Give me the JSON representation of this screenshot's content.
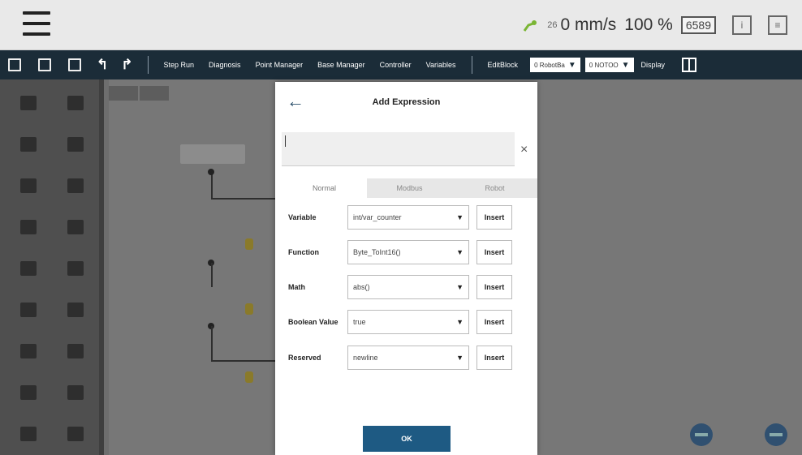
{
  "status": {
    "speed_value": "0 mm/s",
    "speed_prefix": "26",
    "override": "100 %",
    "counter": "6589"
  },
  "toolbar": {
    "step_run": "Step Run",
    "diagnosis": "Diagnosis",
    "point_manager": "Point Manager",
    "base_manager": "Base Manager",
    "controller": "Controller",
    "variables": "Variables",
    "edit_block": "EditBlock",
    "robot_dd": "0 RobotBa",
    "tool_dd": "0 NOTOO",
    "display": "Display"
  },
  "dialog": {
    "title": "Add Expression",
    "expression_value": "",
    "tabs": [
      "Normal",
      "Modbus",
      "Robot"
    ],
    "active_tab": "Normal",
    "rows": [
      {
        "label": "Variable",
        "value": "int/var_counter",
        "button": "Insert"
      },
      {
        "label": "Function",
        "value": "Byte_ToInt16()",
        "button": "Insert"
      },
      {
        "label": "Math",
        "value": "abs()",
        "button": "Insert"
      },
      {
        "label": "Boolean Value",
        "value": "true",
        "button": "Insert"
      },
      {
        "label": "Reserved",
        "value": "newline",
        "button": "Insert"
      }
    ],
    "ok_label": "OK"
  },
  "colors": {
    "toolbar_bg": "#1b2c38",
    "ok_button": "#1e5a83",
    "back_arrow": "#2a4f6a"
  }
}
